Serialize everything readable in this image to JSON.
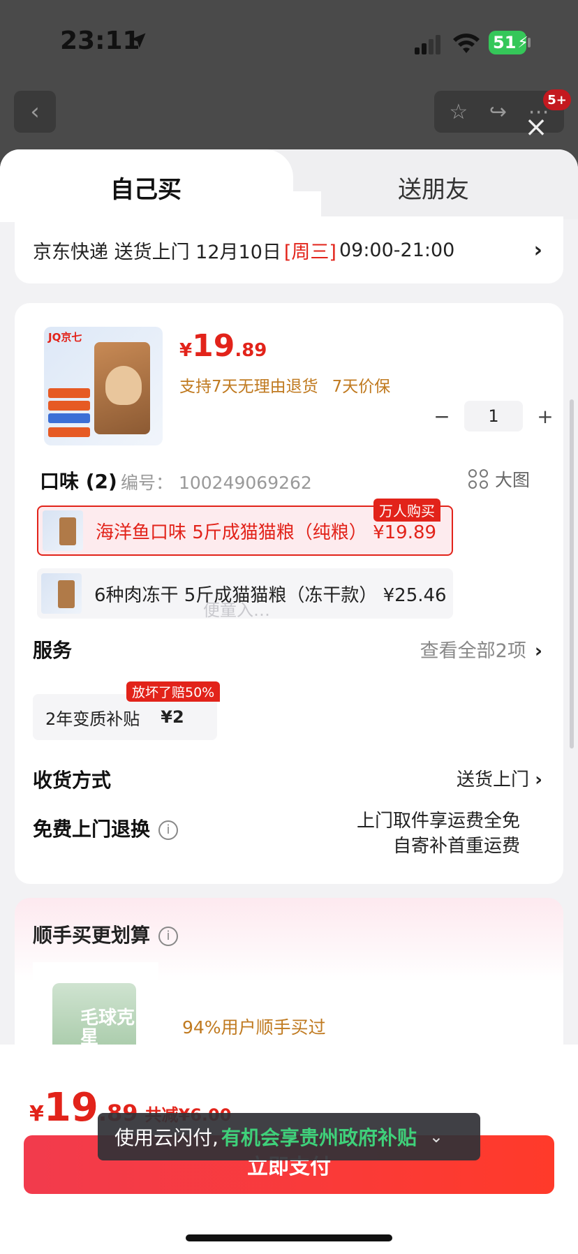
{
  "status_bar": {
    "time": "23:11",
    "battery": "51"
  },
  "header": {
    "back_icon": "chevron-left-icon",
    "badge": "5+"
  },
  "tabs": [
    {
      "label": "自己买",
      "active": true
    },
    {
      "label": "送朋友",
      "active": false
    }
  ],
  "delivery": {
    "carrier": "京东快递 送货上门 12月10日",
    "weekday": "[周三]",
    "window": "09:00-21:00"
  },
  "product": {
    "logo": "JQ京七",
    "price_currency": "¥",
    "price_int": "19",
    "price_dec": ".89",
    "guarantees": [
      "支持7天无理由退货",
      "7天价保"
    ],
    "quantity": "1",
    "minus": "−",
    "plus": "+"
  },
  "flavor": {
    "title": "口味 (2)",
    "sku_no": "编号： 100249069262",
    "big_view": "大图",
    "options": [
      {
        "label": "海洋鱼口味 5斤成猫猫粮（纯粮） ¥19.89",
        "selected": true,
        "badge": "万人购买"
      },
      {
        "label": "6种肉冻干 5斤成猫猫粮（冻干款） ¥25.46",
        "selected": false
      }
    ],
    "watermark": "便童入…"
  },
  "service": {
    "title": "服务",
    "view_all": "查看全部2项",
    "item_label": "2年变质补贴",
    "item_price": "¥2",
    "item_badge": "放坏了赔50%"
  },
  "shipping": {
    "title": "收货方式",
    "value": "送货上门"
  },
  "free_return": {
    "title": "免费上门退换",
    "line1": "上门取件享运费全免",
    "line2": "自寄补首重运费"
  },
  "addon": {
    "title": "顺手买更划算",
    "subtitle": "94%用户顺手买过",
    "product_text": "毛球克星"
  },
  "toast": {
    "prefix": "使用云闪付,",
    "highlight": "有机会享贵州政府补贴"
  },
  "footer": {
    "currency": "¥",
    "total_int": "19",
    "total_dec": ".89",
    "discount": "共减¥6.00",
    "pay_label": "立即支付"
  },
  "colors": {
    "accent": "#e2231a",
    "promo_text": "#c07a20",
    "toast_green": "#3fd07a"
  }
}
